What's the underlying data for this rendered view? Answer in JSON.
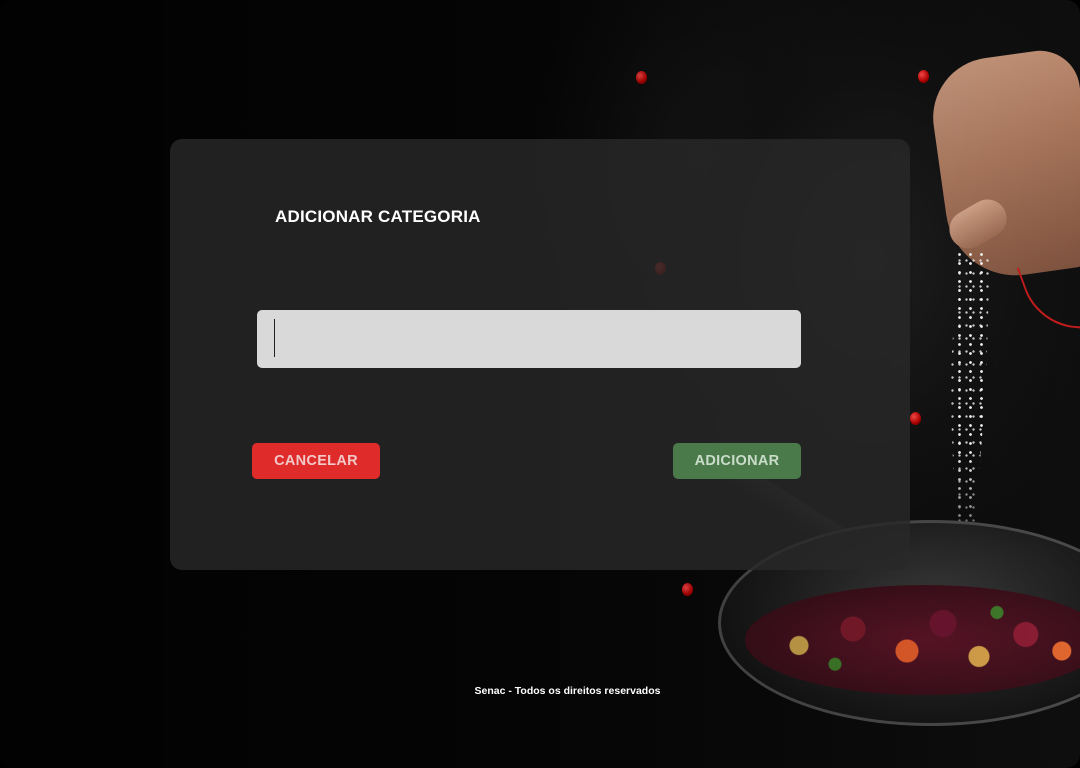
{
  "background": {
    "image_icon": "chef-cooking-photo",
    "accent": "#c41c1c"
  },
  "modal": {
    "title": "ADICIONAR CATEGORIA",
    "input": {
      "value": "",
      "placeholder": ""
    },
    "cancel_label": "CANCELAR",
    "add_label": "ADICIONAR",
    "colors": {
      "panel": "#282828",
      "input": "#d9d9d9",
      "cancel": "#e02b2b",
      "add": "#4a7a4a"
    }
  },
  "footer": {
    "text": "Senac - Todos os direitos reservados"
  }
}
